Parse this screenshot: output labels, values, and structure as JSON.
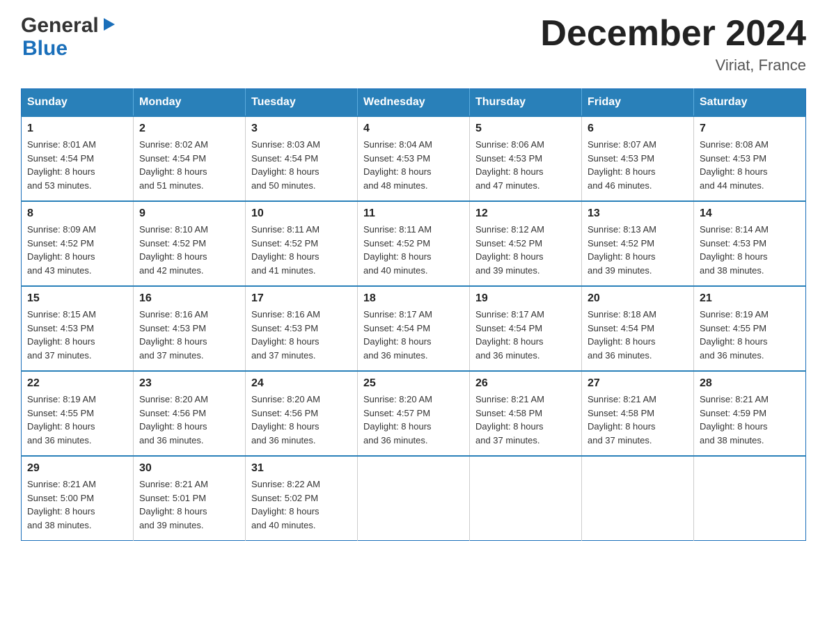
{
  "header": {
    "month_title": "December 2024",
    "location": "Viriat, France",
    "logo_general": "General",
    "logo_blue": "Blue"
  },
  "weekdays": [
    "Sunday",
    "Monday",
    "Tuesday",
    "Wednesday",
    "Thursday",
    "Friday",
    "Saturday"
  ],
  "weeks": [
    [
      {
        "day": "1",
        "sunrise": "Sunrise: 8:01 AM",
        "sunset": "Sunset: 4:54 PM",
        "daylight": "Daylight: 8 hours",
        "daylight2": "and 53 minutes."
      },
      {
        "day": "2",
        "sunrise": "Sunrise: 8:02 AM",
        "sunset": "Sunset: 4:54 PM",
        "daylight": "Daylight: 8 hours",
        "daylight2": "and 51 minutes."
      },
      {
        "day": "3",
        "sunrise": "Sunrise: 8:03 AM",
        "sunset": "Sunset: 4:54 PM",
        "daylight": "Daylight: 8 hours",
        "daylight2": "and 50 minutes."
      },
      {
        "day": "4",
        "sunrise": "Sunrise: 8:04 AM",
        "sunset": "Sunset: 4:53 PM",
        "daylight": "Daylight: 8 hours",
        "daylight2": "and 48 minutes."
      },
      {
        "day": "5",
        "sunrise": "Sunrise: 8:06 AM",
        "sunset": "Sunset: 4:53 PM",
        "daylight": "Daylight: 8 hours",
        "daylight2": "and 47 minutes."
      },
      {
        "day": "6",
        "sunrise": "Sunrise: 8:07 AM",
        "sunset": "Sunset: 4:53 PM",
        "daylight": "Daylight: 8 hours",
        "daylight2": "and 46 minutes."
      },
      {
        "day": "7",
        "sunrise": "Sunrise: 8:08 AM",
        "sunset": "Sunset: 4:53 PM",
        "daylight": "Daylight: 8 hours",
        "daylight2": "and 44 minutes."
      }
    ],
    [
      {
        "day": "8",
        "sunrise": "Sunrise: 8:09 AM",
        "sunset": "Sunset: 4:52 PM",
        "daylight": "Daylight: 8 hours",
        "daylight2": "and 43 minutes."
      },
      {
        "day": "9",
        "sunrise": "Sunrise: 8:10 AM",
        "sunset": "Sunset: 4:52 PM",
        "daylight": "Daylight: 8 hours",
        "daylight2": "and 42 minutes."
      },
      {
        "day": "10",
        "sunrise": "Sunrise: 8:11 AM",
        "sunset": "Sunset: 4:52 PM",
        "daylight": "Daylight: 8 hours",
        "daylight2": "and 41 minutes."
      },
      {
        "day": "11",
        "sunrise": "Sunrise: 8:11 AM",
        "sunset": "Sunset: 4:52 PM",
        "daylight": "Daylight: 8 hours",
        "daylight2": "and 40 minutes."
      },
      {
        "day": "12",
        "sunrise": "Sunrise: 8:12 AM",
        "sunset": "Sunset: 4:52 PM",
        "daylight": "Daylight: 8 hours",
        "daylight2": "and 39 minutes."
      },
      {
        "day": "13",
        "sunrise": "Sunrise: 8:13 AM",
        "sunset": "Sunset: 4:52 PM",
        "daylight": "Daylight: 8 hours",
        "daylight2": "and 39 minutes."
      },
      {
        "day": "14",
        "sunrise": "Sunrise: 8:14 AM",
        "sunset": "Sunset: 4:53 PM",
        "daylight": "Daylight: 8 hours",
        "daylight2": "and 38 minutes."
      }
    ],
    [
      {
        "day": "15",
        "sunrise": "Sunrise: 8:15 AM",
        "sunset": "Sunset: 4:53 PM",
        "daylight": "Daylight: 8 hours",
        "daylight2": "and 37 minutes."
      },
      {
        "day": "16",
        "sunrise": "Sunrise: 8:16 AM",
        "sunset": "Sunset: 4:53 PM",
        "daylight": "Daylight: 8 hours",
        "daylight2": "and 37 minutes."
      },
      {
        "day": "17",
        "sunrise": "Sunrise: 8:16 AM",
        "sunset": "Sunset: 4:53 PM",
        "daylight": "Daylight: 8 hours",
        "daylight2": "and 37 minutes."
      },
      {
        "day": "18",
        "sunrise": "Sunrise: 8:17 AM",
        "sunset": "Sunset: 4:54 PM",
        "daylight": "Daylight: 8 hours",
        "daylight2": "and 36 minutes."
      },
      {
        "day": "19",
        "sunrise": "Sunrise: 8:17 AM",
        "sunset": "Sunset: 4:54 PM",
        "daylight": "Daylight: 8 hours",
        "daylight2": "and 36 minutes."
      },
      {
        "day": "20",
        "sunrise": "Sunrise: 8:18 AM",
        "sunset": "Sunset: 4:54 PM",
        "daylight": "Daylight: 8 hours",
        "daylight2": "and 36 minutes."
      },
      {
        "day": "21",
        "sunrise": "Sunrise: 8:19 AM",
        "sunset": "Sunset: 4:55 PM",
        "daylight": "Daylight: 8 hours",
        "daylight2": "and 36 minutes."
      }
    ],
    [
      {
        "day": "22",
        "sunrise": "Sunrise: 8:19 AM",
        "sunset": "Sunset: 4:55 PM",
        "daylight": "Daylight: 8 hours",
        "daylight2": "and 36 minutes."
      },
      {
        "day": "23",
        "sunrise": "Sunrise: 8:20 AM",
        "sunset": "Sunset: 4:56 PM",
        "daylight": "Daylight: 8 hours",
        "daylight2": "and 36 minutes."
      },
      {
        "day": "24",
        "sunrise": "Sunrise: 8:20 AM",
        "sunset": "Sunset: 4:56 PM",
        "daylight": "Daylight: 8 hours",
        "daylight2": "and 36 minutes."
      },
      {
        "day": "25",
        "sunrise": "Sunrise: 8:20 AM",
        "sunset": "Sunset: 4:57 PM",
        "daylight": "Daylight: 8 hours",
        "daylight2": "and 36 minutes."
      },
      {
        "day": "26",
        "sunrise": "Sunrise: 8:21 AM",
        "sunset": "Sunset: 4:58 PM",
        "daylight": "Daylight: 8 hours",
        "daylight2": "and 37 minutes."
      },
      {
        "day": "27",
        "sunrise": "Sunrise: 8:21 AM",
        "sunset": "Sunset: 4:58 PM",
        "daylight": "Daylight: 8 hours",
        "daylight2": "and 37 minutes."
      },
      {
        "day": "28",
        "sunrise": "Sunrise: 8:21 AM",
        "sunset": "Sunset: 4:59 PM",
        "daylight": "Daylight: 8 hours",
        "daylight2": "and 38 minutes."
      }
    ],
    [
      {
        "day": "29",
        "sunrise": "Sunrise: 8:21 AM",
        "sunset": "Sunset: 5:00 PM",
        "daylight": "Daylight: 8 hours",
        "daylight2": "and 38 minutes."
      },
      {
        "day": "30",
        "sunrise": "Sunrise: 8:21 AM",
        "sunset": "Sunset: 5:01 PM",
        "daylight": "Daylight: 8 hours",
        "daylight2": "and 39 minutes."
      },
      {
        "day": "31",
        "sunrise": "Sunrise: 8:22 AM",
        "sunset": "Sunset: 5:02 PM",
        "daylight": "Daylight: 8 hours",
        "daylight2": "and 40 minutes."
      },
      {
        "day": "",
        "sunrise": "",
        "sunset": "",
        "daylight": "",
        "daylight2": ""
      },
      {
        "day": "",
        "sunrise": "",
        "sunset": "",
        "daylight": "",
        "daylight2": ""
      },
      {
        "day": "",
        "sunrise": "",
        "sunset": "",
        "daylight": "",
        "daylight2": ""
      },
      {
        "day": "",
        "sunrise": "",
        "sunset": "",
        "daylight": "",
        "daylight2": ""
      }
    ]
  ]
}
